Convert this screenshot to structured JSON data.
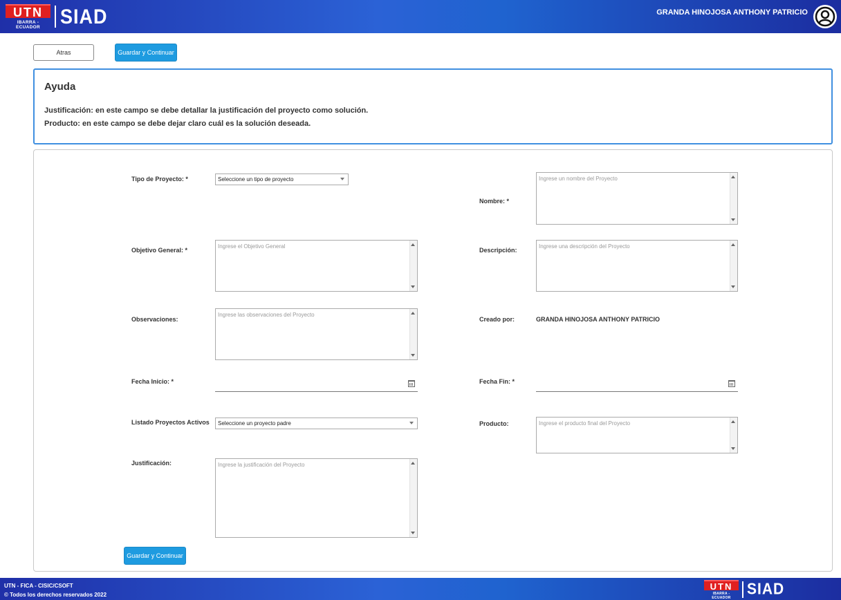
{
  "header": {
    "logo_mark": "UTN",
    "logo_sub": "IBARRA - ECUADOR",
    "app_name": "SIAD",
    "user_name": "GRANDA HINOJOSA ANTHONY PATRICIO"
  },
  "toolbar": {
    "back_label": "Atras",
    "save_label": "Guardar y Continuar"
  },
  "help": {
    "title": "Ayuda",
    "line1": "Justificación: en este campo se debe detallar la justificación del proyecto como solución.",
    "line2": "Producto: en este campo se debe dejar claro cuál es la solución deseada."
  },
  "form": {
    "tipo_label": "Tipo de Proyecto: *",
    "tipo_value": "Seleccione un tipo de proyecto",
    "nombre_label": "Nombre: *",
    "nombre_placeholder": "Ingrese un nombre del Proyecto",
    "objetivo_label": "Objetivo General: *",
    "objetivo_placeholder": "Ingrese el Objetivo General",
    "descripcion_label": "Descripción:",
    "descripcion_placeholder": "Ingrese una descripción del Proyecto",
    "observaciones_label": "Observaciones:",
    "observaciones_placeholder": "Ingrese las observaciones del Proyecto",
    "creado_label": "Creado por:",
    "creado_value": "GRANDA HINOJOSA ANTHONY PATRICIO",
    "fecha_inicio_label": "Fecha Inicio: *",
    "fecha_fin_label": "Fecha Fin: *",
    "listado_label": "Listado Proyectos Activos",
    "listado_value": "Seleccione un proyecto padre",
    "producto_label": "Producto:",
    "producto_placeholder": "Ingrese el producto final del Proyecto",
    "justificacion_label": "Justificación:",
    "justificacion_placeholder": "Ingrese la justificación del Proyecto",
    "submit_label": "Guardar y Continuar"
  },
  "footer": {
    "line1": "UTN - FICA - CISIC/CSOFT",
    "line2": "© Todos los derechos reservados 2022",
    "logo_mark": "UTN",
    "logo_sub": "IBARRA - ECUADOR",
    "app_name": "SIAD"
  },
  "colors": {
    "header_gradient_start": "#1f2fa8",
    "header_gradient_mid": "#2b62d6",
    "primary_button": "#1e9be0",
    "help_border": "#3f8fe0"
  }
}
